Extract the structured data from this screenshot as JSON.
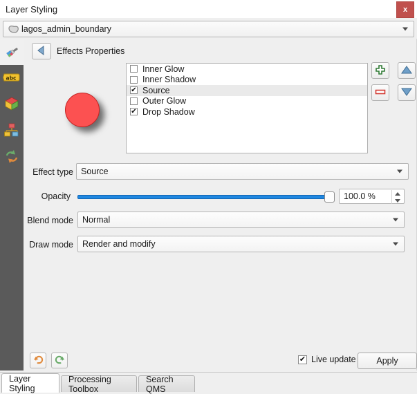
{
  "window": {
    "title": "Layer Styling",
    "close_label": "x",
    "close_color": "#c0504d"
  },
  "layer_selector": {
    "icon": "polygon-layer-icon",
    "value": "lagos_admin_boundary",
    "dropdown_icon": "chevron-down-icon"
  },
  "sidebar": {
    "items": [
      {
        "icon": "paintbrush-symbology-icon",
        "name": "symbology",
        "active": true
      },
      {
        "icon": "abc-labels-icon",
        "name": "labels",
        "active": false
      },
      {
        "icon": "cube-3d-view-icon",
        "name": "3d-view",
        "active": false
      },
      {
        "icon": "diagram-icon",
        "name": "diagrams",
        "active": false
      },
      {
        "icon": "history-arrows-icon",
        "name": "history",
        "active": false
      }
    ]
  },
  "panel": {
    "back_icon": "back-arrow-icon",
    "heading": "Effects Properties"
  },
  "preview": {
    "shape": "circle",
    "fill_color": "#fc5151",
    "stroke_color": "#c32222",
    "has_drop_shadow": true
  },
  "effects_list": [
    {
      "label": "Inner Glow",
      "checked": false,
      "selected": false
    },
    {
      "label": "Inner Shadow",
      "checked": false,
      "selected": false
    },
    {
      "label": "Source",
      "checked": true,
      "selected": true
    },
    {
      "label": "Outer Glow",
      "checked": false,
      "selected": false
    },
    {
      "label": "Drop Shadow",
      "checked": true,
      "selected": false
    }
  ],
  "list_buttons": [
    {
      "name": "add-effect-button",
      "icon": "green-plus-icon",
      "color": "#2f7a34"
    },
    {
      "name": "move-up-button",
      "icon": "blue-up-triangle-icon",
      "color": "#5b8dbe"
    },
    {
      "name": "remove-effect-button",
      "icon": "red-minus-icon",
      "color": "#d33a33"
    },
    {
      "name": "move-down-button",
      "icon": "blue-down-triangle-icon",
      "color": "#5b8dbe"
    }
  ],
  "form": {
    "effect_type": {
      "label": "Effect type",
      "value": "Source"
    },
    "opacity": {
      "label": "Opacity",
      "value": "100.0 %",
      "percent": 100
    },
    "blend_mode": {
      "label": "Blend mode",
      "value": "Normal"
    },
    "draw_mode": {
      "label": "Draw mode",
      "value": "Render and modify"
    }
  },
  "bottom_bar": {
    "undo_icon": "undo-arrow-icon",
    "redo_icon": "redo-arrow-icon",
    "live_update": {
      "label": "Live update",
      "checked": true
    },
    "apply_label": "Apply"
  },
  "tabs": [
    {
      "label": "Layer Styling",
      "active": true
    },
    {
      "label": "Processing Toolbox",
      "active": false
    },
    {
      "label": "Search QMS",
      "active": false
    }
  ],
  "checkmark": "✔"
}
